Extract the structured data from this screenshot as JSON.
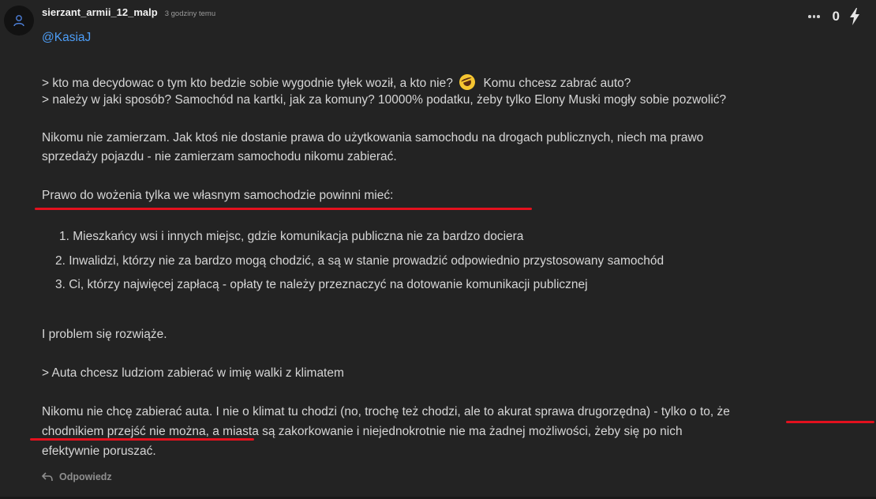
{
  "comment": {
    "username": "sierzant_armii_12_malp",
    "timestamp": "3 godziny temu",
    "score": "0",
    "mention": "@KasiaJ",
    "quote_line_1_part_1": "> kto ma decydowac o tym kto bedzie sobie wygodnie tyłek woził, a kto nie?",
    "quote_line_1_part_2": "Komu chcesz zabrać auto?",
    "quote_line_2": "> należy w jaki sposób? Samochód na kartki, jak za komuny? 10000% podatku, żeby tylko Elony Muski mogły sobie pozwolić?",
    "para_1_line_1": "Nikomu nie zamierzam. Jak ktoś nie dostanie prawa do użytkowania samochodu na drogach publicznych, niech ma prawo",
    "para_1_line_2": "sprzedaży pojazdu - nie zamierzam samochodu nikomu zabierać.",
    "para_2": "Prawo do wożenia tylka we własnym samochodzie powinni mieć:",
    "list": [
      "1. Mieszkańcy wsi i innych miejsc, gdzie komunikacja publiczna nie za bardzo dociera",
      "2. Inwalidzi, którzy nie za bardzo mogą chodzić, a są w stanie prowadzić odpowiednio przystosowany samochód",
      "3. Ci, którzy najwięcej zapłacą - opłaty te należy przeznaczyć na dotowanie komunikacji publicznej"
    ],
    "para_3": "I problem się rozwiąże.",
    "quote_3": "> Auta chcesz ludziom zabierać w imię walki z klimatem",
    "para_4_line_1": "Nikomu nie chcę zabierać auta. I nie o klimat tu chodzi (no, trochę też chodzi, ale to akurat sprawa drugorzędna) - tylko o to, że",
    "para_4_line_2": "chodnikiem przejść nie można, a miasta są zakorkowanie i niejednokrotnie nie ma żadnej możliwości, żeby się po nich",
    "para_4_line_3": "efektywnie poruszać.",
    "reply_label": "Odpowiedz"
  },
  "icons": {
    "avatar": "user-icon",
    "more": "more-dots-icon",
    "vote": "bolt-icon",
    "reply": "reply-arrow-icon",
    "emoji": "rolling-laughing-emoji-icon"
  },
  "colors": {
    "background": "#232323",
    "mention": "#4d9ef7",
    "highlight_underline": "#e3111e",
    "text": "#d6d6d6"
  }
}
